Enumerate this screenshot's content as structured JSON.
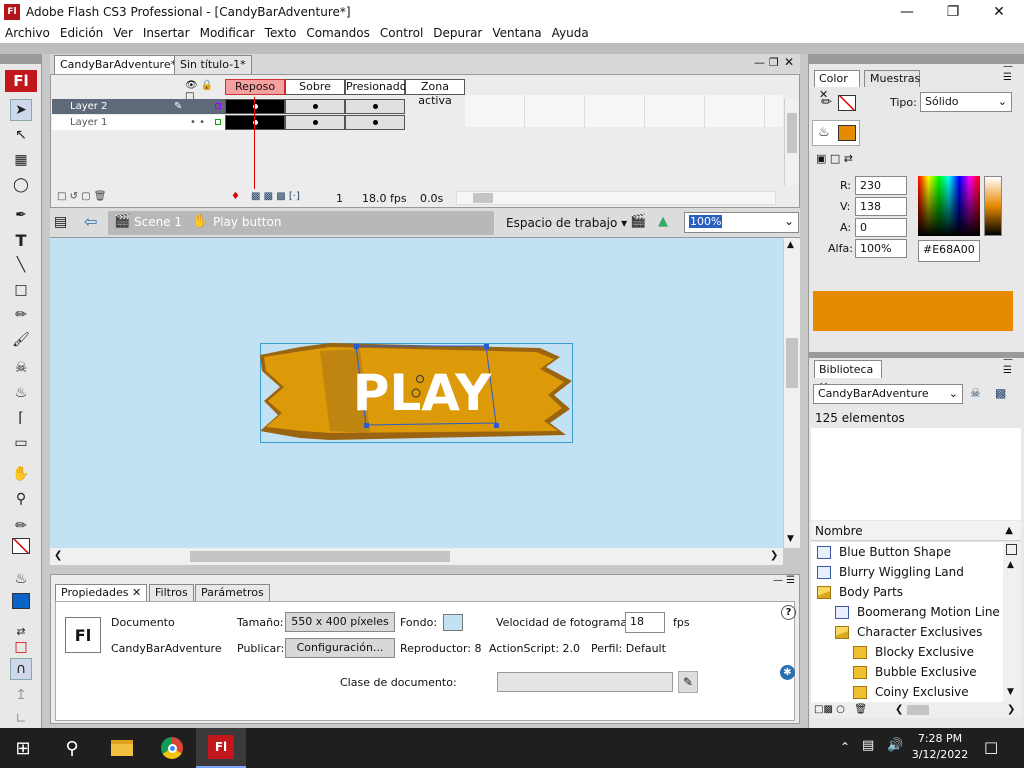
{
  "window": {
    "title": "Adobe Flash CS3 Professional - [CandyBarAdventure*]",
    "app_badge": "Fl"
  },
  "menu": [
    "Archivo",
    "Edición",
    "Ver",
    "Insertar",
    "Modificar",
    "Texto",
    "Comandos",
    "Control",
    "Depurar",
    "Ventana",
    "Ayuda"
  ],
  "doc_tabs": [
    "CandyBarAdventure*",
    "Sin título-1*"
  ],
  "timeline": {
    "states": [
      "Reposo",
      "Sobre",
      "Presionado",
      "Zona activa"
    ],
    "layers": [
      "Layer 2",
      "Layer 1"
    ],
    "frame_number": "1",
    "fps": "18.0 fps",
    "time": "0.0s"
  },
  "editbar": {
    "scene": "Scene 1",
    "symbol": "Play button",
    "workspace": "Espacio de trabajo",
    "zoom": "100%"
  },
  "stage": {
    "play_text": "PLAY",
    "candy_color": "#E68A00",
    "bg_color": "#C2E1F2"
  },
  "properties": {
    "tabs": [
      "Propiedades",
      "Filtros",
      "Parámetros"
    ],
    "type_icon": "Fl",
    "doc_label": "Documento",
    "doc_name": "CandyBarAdventure",
    "size_label": "Tamaño:",
    "size_value": "550 x 400 píxeles",
    "bg_label": "Fondo:",
    "fps_label": "Velocidad de fotogramas:",
    "fps_value": "18",
    "fps_unit": "fps",
    "publish_label": "Publicar:",
    "config_button": "Configuración...",
    "player": "Reproductor: 8",
    "actionscript": "ActionScript: 2.0",
    "profile": "Perfil: Default",
    "class_label": "Clase de documento:"
  },
  "color_panel": {
    "tabs": [
      "Color",
      "Muestras"
    ],
    "type_label": "Tipo:",
    "type_value": "Sólido",
    "r_label": "R:",
    "r_value": "230",
    "g_label": "V:",
    "g_value": "138",
    "b_label": "A:",
    "b_value": "0",
    "alpha_label": "Alfa:",
    "alpha_value": "100%",
    "hex": "#E68A00",
    "fill_color": "#E68A00"
  },
  "library": {
    "tab": "Biblioteca",
    "doc": "CandyBarAdventure",
    "count": "125 elementos",
    "column": "Nombre",
    "items": [
      {
        "name": "Blue Button Shape",
        "kind": "symbol",
        "indent": 0
      },
      {
        "name": "Blurry Wiggling Land",
        "kind": "symbol",
        "indent": 0
      },
      {
        "name": "Body Parts",
        "kind": "folder-open",
        "indent": 0
      },
      {
        "name": "Boomerang Motion Line",
        "kind": "symbol",
        "indent": 1
      },
      {
        "name": "Character Exclusives",
        "kind": "folder-open",
        "indent": 1
      },
      {
        "name": "Blocky Exclusive",
        "kind": "folder",
        "indent": 2
      },
      {
        "name": "Bubble Exclusive",
        "kind": "folder",
        "indent": 2
      },
      {
        "name": "Coiny Exclusive",
        "kind": "folder",
        "indent": 2
      }
    ]
  },
  "taskbar": {
    "time": "7:28 PM",
    "date": "3/12/2022"
  }
}
